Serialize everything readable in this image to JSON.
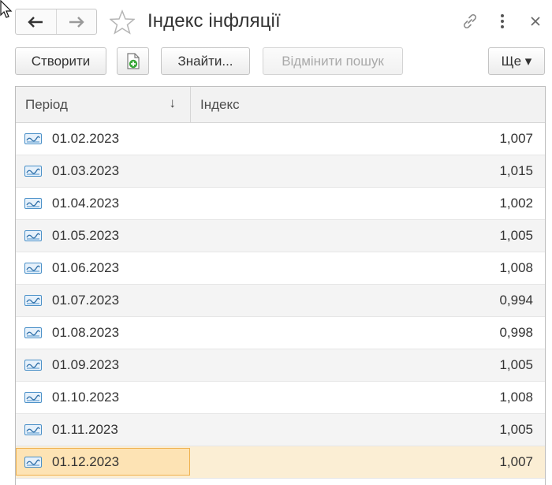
{
  "window": {
    "title": "Індекс інфляції",
    "icons": {
      "back": "arrow-left-icon",
      "forward": "arrow-right-icon",
      "favorite": "star-icon",
      "link": "link-icon",
      "more": "kebab-menu-icon",
      "close": "close-icon"
    }
  },
  "toolbar": {
    "create_label": "Створити",
    "add_icon": "add-document-icon",
    "find_label": "Знайти...",
    "cancel_search_label": "Відмінити пошук",
    "more_label": "Ще ▾"
  },
  "table": {
    "columns": {
      "period": "Період",
      "index": "Індекс",
      "sort_indicator": "↓"
    },
    "row_icon": "register-record-icon",
    "rows": [
      {
        "period": "01.02.2023",
        "index": "1,007"
      },
      {
        "period": "01.03.2023",
        "index": "1,015"
      },
      {
        "period": "01.04.2023",
        "index": "1,002"
      },
      {
        "period": "01.05.2023",
        "index": "1,005"
      },
      {
        "period": "01.06.2023",
        "index": "1,008"
      },
      {
        "period": "01.07.2023",
        "index": "0,994"
      },
      {
        "period": "01.08.2023",
        "index": "0,998"
      },
      {
        "period": "01.09.2023",
        "index": "1,005"
      },
      {
        "period": "01.10.2023",
        "index": "1,008"
      },
      {
        "period": "01.11.2023",
        "index": "1,005"
      },
      {
        "period": "01.12.2023",
        "index": "1,007",
        "selected": true
      }
    ]
  },
  "colors": {
    "selected_row": "#fbeed4",
    "selected_cell": "#fde3b4",
    "selected_border": "#f0b24f",
    "add_icon_green": "#3aa83a",
    "record_icon_blue": "#4a90c8"
  }
}
